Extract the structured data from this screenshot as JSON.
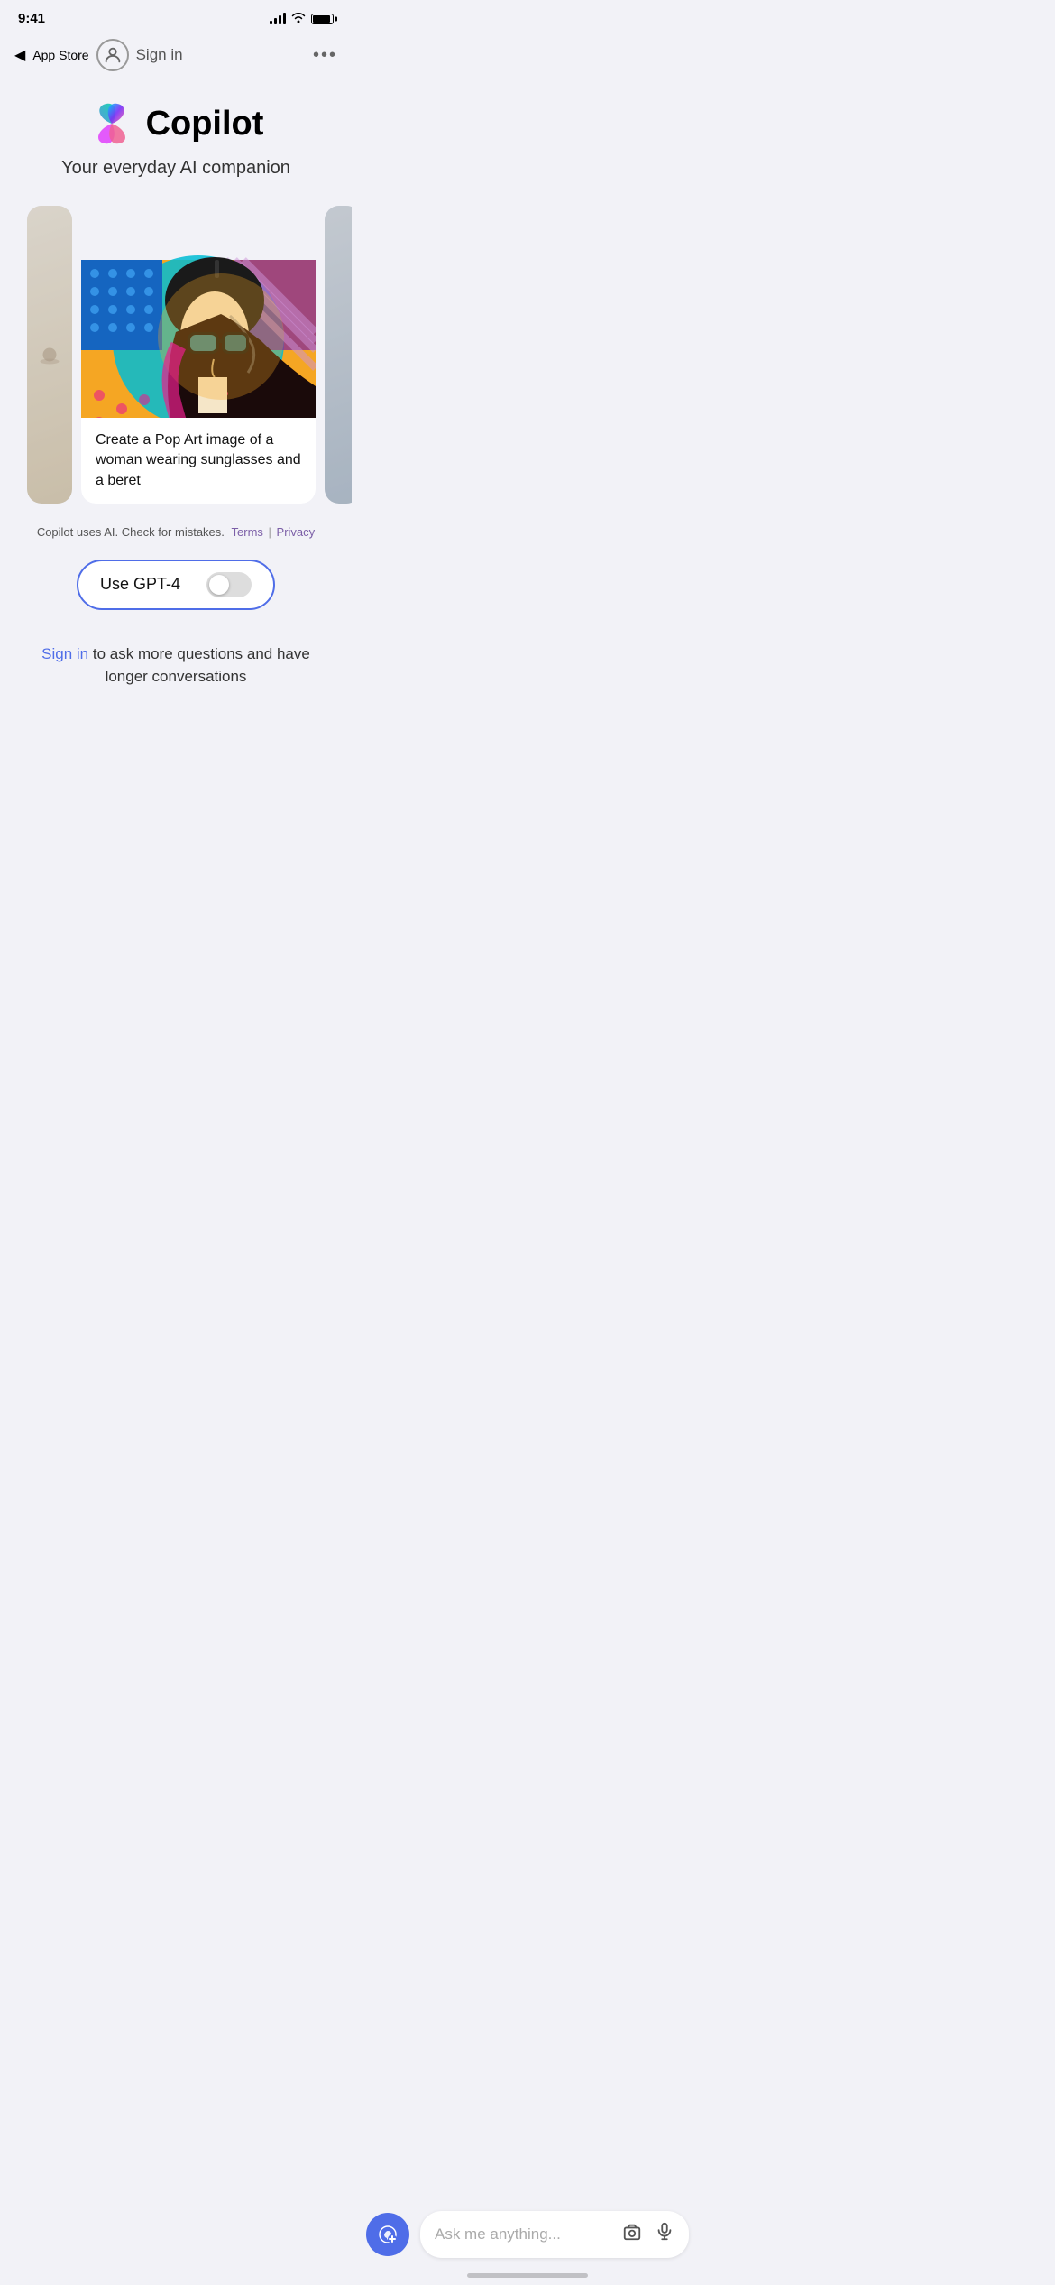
{
  "statusBar": {
    "time": "9:41",
    "backLabel": "App Store"
  },
  "nav": {
    "signinLabel": "Sign in",
    "moreLabel": "•••"
  },
  "hero": {
    "appName": "Copilot",
    "subtitle": "Your everyday AI companion"
  },
  "carousel": {
    "caption": "Create a Pop Art image of a woman wearing sunglasses and a beret"
  },
  "disclaimer": {
    "text": "Copilot uses AI. Check for mistakes.",
    "termsLabel": "Terms",
    "privacyLabel": "Privacy"
  },
  "gpt4": {
    "label": "Use GPT-4"
  },
  "signinBanner": {
    "linkLabel": "Sign in",
    "restText": " to ask more questions and have longer conversations"
  },
  "searchBar": {
    "placeholder": "Ask me anything...",
    "cameraIconLabel": "camera-icon",
    "micIconLabel": "mic-icon"
  },
  "newChatBtn": {
    "label": "New chat"
  }
}
